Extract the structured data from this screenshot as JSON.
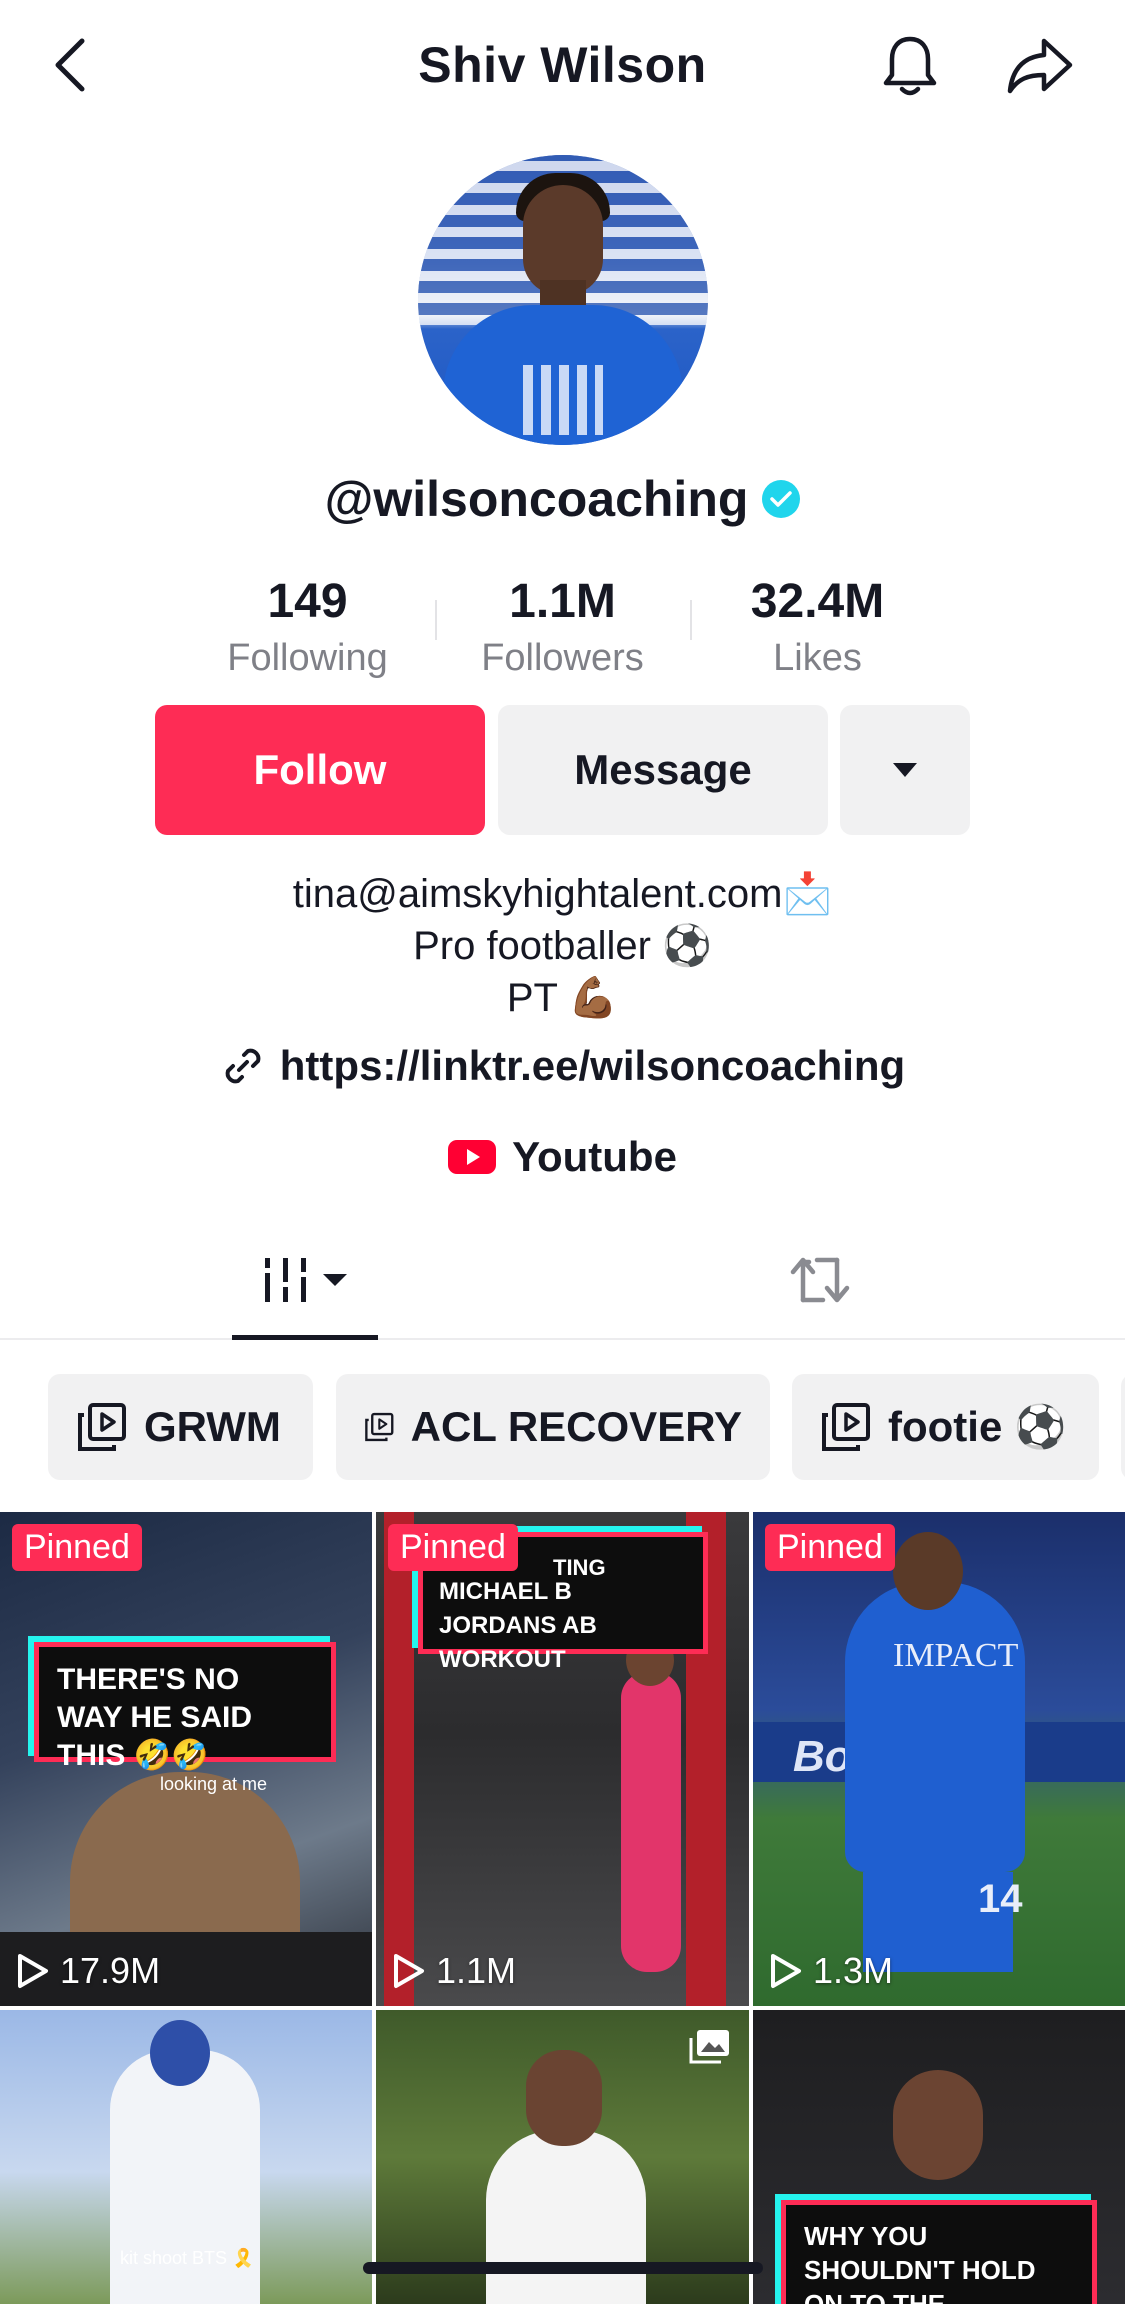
{
  "header": {
    "title": "Shiv Wilson"
  },
  "profile": {
    "handle": "@wilsoncoaching",
    "verified": true
  },
  "stats": [
    {
      "value": "149",
      "label": "Following"
    },
    {
      "value": "1.1M",
      "label": "Followers"
    },
    {
      "value": "32.4M",
      "label": "Likes"
    }
  ],
  "actions": {
    "follow_label": "Follow",
    "message_label": "Message"
  },
  "bio": {
    "line1": "tina@aimskyhightalent.com📩",
    "line2": "Pro footballer ⚽️",
    "line3": "PT 💪🏾",
    "link": "https://linktr.ee/wilsoncoaching",
    "youtube_label": "Youtube"
  },
  "playlists": [
    {
      "label": "GRWM"
    },
    {
      "label": "ACL RECOVERY"
    },
    {
      "label": "footie ⚽️"
    }
  ],
  "videos": [
    {
      "pinned": "Pinned",
      "caption": "THERE'S NO WAY HE SAID THIS 🤣🤣",
      "subtitle": "looking at me",
      "views": "17.9M"
    },
    {
      "pinned": "Pinned",
      "caption": "MICHAEL B JORDANS AB WORKOUT",
      "caption_partial": "TING",
      "views": "1.1M"
    },
    {
      "pinned": "Pinned",
      "shirt_text": "IMPACT",
      "board_text": "Boyle",
      "number": "14",
      "views": "1.3M"
    },
    {
      "subtitle": "kit shoot BTS 🎗️"
    },
    {
      "icon": "photo-icon"
    },
    {
      "caption": "WHY YOU SHOULDN'T HOLD ON TO THE HANDLES ON THE"
    }
  ],
  "colors": {
    "brand_red": "#fe2c55",
    "brand_cyan": "#25f4ee",
    "verified": "#20d5ec",
    "youtube_red": "#ff0033"
  }
}
